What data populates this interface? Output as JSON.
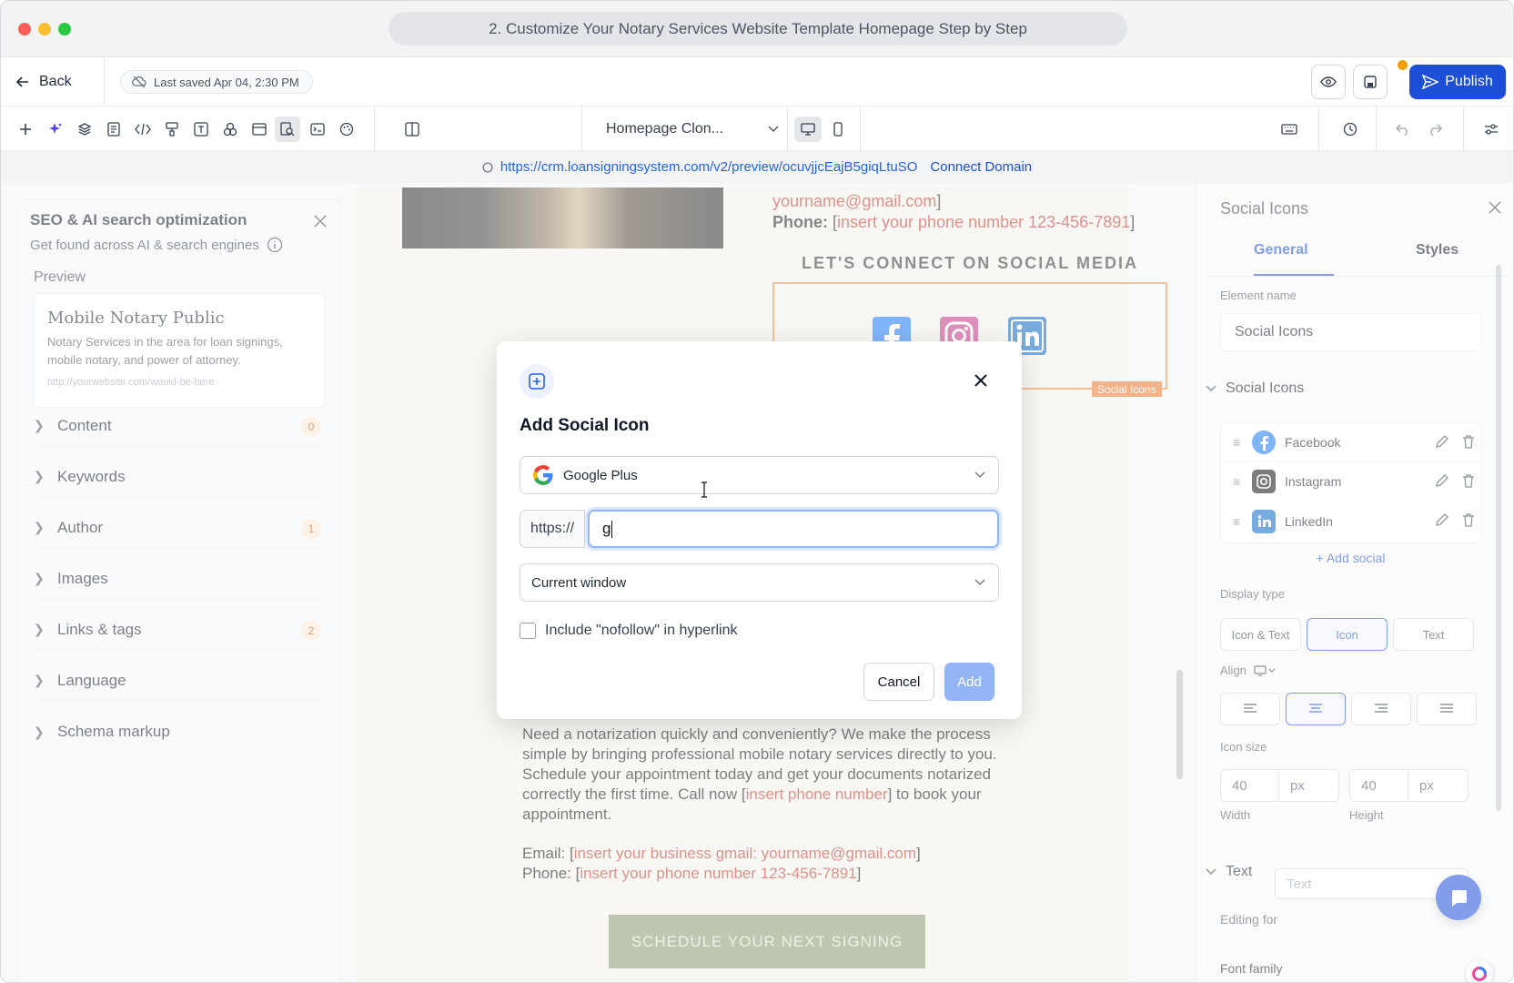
{
  "window": {
    "tab_title": "2. Customize Your Notary Services Website Template Homepage Step by Step",
    "traffic_colors": {
      "close": "#ff5f57",
      "minimize": "#febc2e",
      "maximize": "#28c840"
    }
  },
  "appbar": {
    "back_label": "Back",
    "last_saved": "Last saved Apr 04, 2:30 PM",
    "publish_label": "Publish",
    "accent": "#1d4ed8"
  },
  "toolbar": {
    "page_name": "Homepage Clon...",
    "icons": [
      "plus-icon",
      "sparkle-icon",
      "layers-icon",
      "pages-icon",
      "code-icon",
      "paint-icon",
      "text-icon",
      "shapes-icon",
      "browser-icon",
      "seo-icon",
      "terminal-icon",
      "palette-icon",
      "columns-icon",
      "desktop-icon",
      "mobile-icon",
      "keyboard-icon",
      "history-icon",
      "undo-icon",
      "redo-icon",
      "settings-sliders-icon"
    ]
  },
  "urlbar": {
    "url": "https://crm.loansigningsystem.com/v2/preview/ocuvjjcEajB5giqLtuSO",
    "connect_label": "Connect Domain"
  },
  "seo_panel": {
    "title": "SEO & AI search optimization",
    "subtitle": "Get found across AI & search engines",
    "preview_label": "Preview",
    "preview": {
      "title": "Mobile Notary Public",
      "description": "Notary Services in the area for loan signings, mobile notary, and power of attorney.",
      "url": "http://yourwebsite.com/would-be-here"
    },
    "sections": [
      {
        "label": "Content",
        "badge": "0"
      },
      {
        "label": "Keywords",
        "badge": ""
      },
      {
        "label": "Author",
        "badge": "1"
      },
      {
        "label": "Images",
        "badge": ""
      },
      {
        "label": "Links & tags",
        "badge": "2"
      },
      {
        "label": "Language",
        "badge": ""
      },
      {
        "label": "Schema markup",
        "badge": ""
      }
    ]
  },
  "canvas": {
    "top_email_value": "yourname@gmail.com",
    "top_email_suffix": "]",
    "top_phone_label": "Phone:",
    "top_phone_open": " [",
    "top_phone_value": "insert your phone number 123-456-7891",
    "top_phone_close": "]",
    "connect_heading": "LET'S CONNECT ON SOCIAL MEDIA",
    "social_tag": "Social Icons",
    "body_text_1": "Need a notarization quickly and conveniently? We make the process simple by bringing professional mobile notary services directly to you. Schedule your appointment today and get your documents notarized correctly the first time. Call now [",
    "body_text_red": "insert phone number",
    "body_text_2": "] to book your appointment.",
    "email_label": "Email: [",
    "email_value": "insert your business gmail: yourname@gmail.com",
    "email_close": "]",
    "phone_label": "Phone: [",
    "phone_value": "insert your phone number 123-456-7891",
    "phone_close": "]",
    "schedule_label": "SCHEDULE YOUR NEXT SIGNING"
  },
  "modal": {
    "title": "Add Social Icon",
    "network_value": "Google Plus",
    "url_prefix": "https://",
    "url_value": "g",
    "target_value": "Current window",
    "nofollow_label": "Include \"nofollow\" in hyperlink",
    "nofollow_checked": false,
    "cancel_label": "Cancel",
    "add_label": "Add"
  },
  "right_panel": {
    "title": "Social Icons",
    "tabs": [
      "General",
      "Styles"
    ],
    "element_name_label": "Element name",
    "element_name_value": "Social Icons",
    "section_label": "Social Icons",
    "socials": [
      {
        "label": "Facebook",
        "icon": "facebook-icon"
      },
      {
        "label": "Instagram",
        "icon": "instagram-icon"
      },
      {
        "label": "LinkedIn",
        "icon": "linkedin-icon"
      }
    ],
    "add_social_label": "Add social",
    "display_type_label": "Display type",
    "display_types": [
      "Icon & Text",
      "Icon",
      "Text"
    ],
    "display_type_selected": "Icon",
    "align_label": "Align",
    "icon_size_label": "Icon size",
    "width_value": "40",
    "width_unit": "px",
    "width_label": "Width",
    "height_value": "40",
    "height_unit": "px",
    "height_label": "Height",
    "text_section_label": "Text",
    "editing_for_label": "Editing for",
    "editing_for_value": "Text",
    "font_family_label": "Font family"
  }
}
